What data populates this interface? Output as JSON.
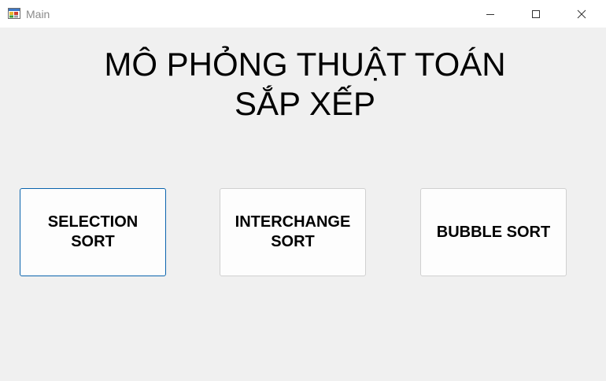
{
  "window": {
    "title": "Main",
    "icon": "app-window-icon",
    "controls": [
      "minimize-icon",
      "maximize-icon",
      "close-icon"
    ]
  },
  "main": {
    "heading_line1": "MÔ PHỎNG THUẬT TOÁN",
    "heading_line2": "SẮP XẾP",
    "buttons": [
      {
        "label_line1": "SELECTION",
        "label_line2": "SORT",
        "focused": true
      },
      {
        "label_line1": "INTERCHANGE",
        "label_line2": "SORT",
        "focused": false
      },
      {
        "label_line1": "BUBBLE SORT",
        "label_line2": "",
        "focused": false
      }
    ]
  },
  "colors": {
    "client_background": "#f0f0f0",
    "titlebar_background": "#ffffff",
    "focus_border": "#0a64ad",
    "button_border": "#d0d0d0"
  }
}
